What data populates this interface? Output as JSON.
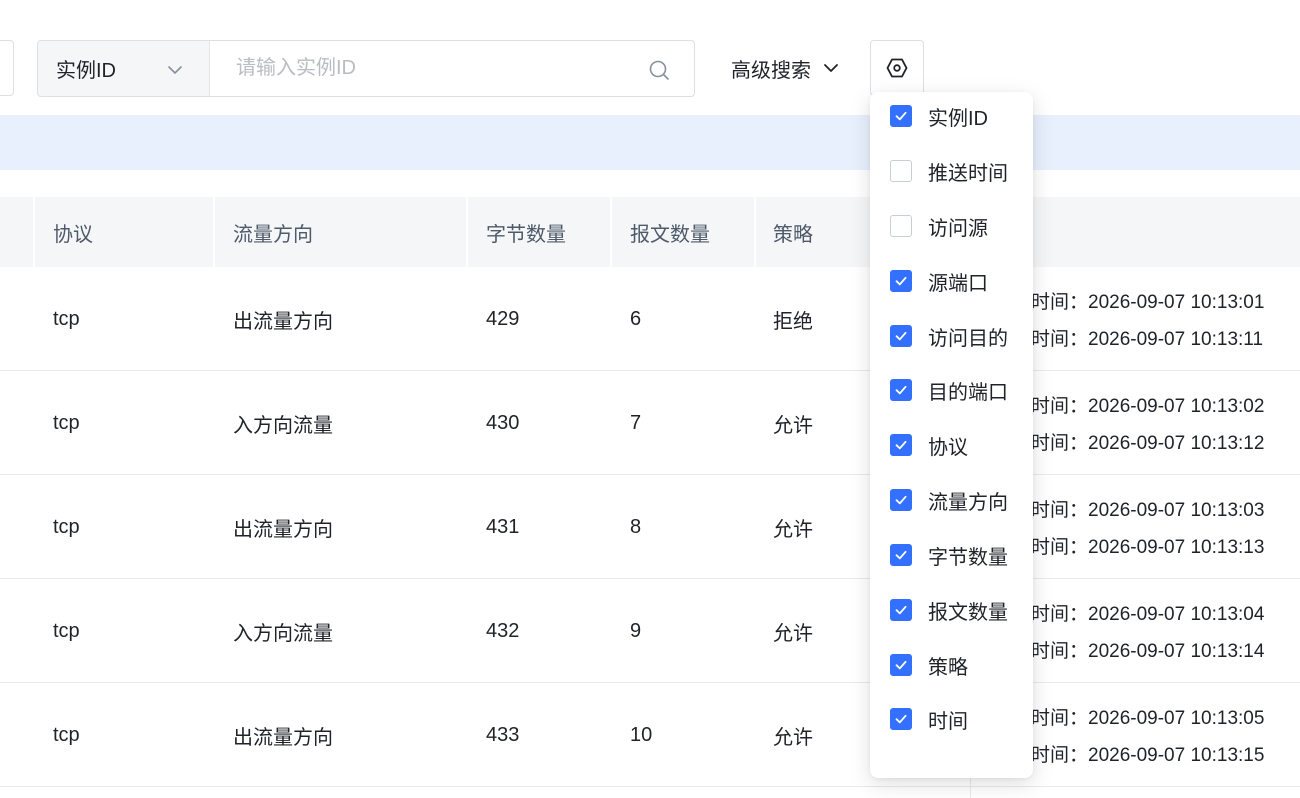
{
  "toolbar": {
    "select_value": "实例ID",
    "search_placeholder": "请输入实例ID",
    "advanced_search_label": "高级搜索"
  },
  "table": {
    "headers": [
      "协议",
      "流量方向",
      "字节数量",
      "报文数量",
      "策略"
    ],
    "rows": [
      {
        "protocol": "tcp",
        "direction": "出流量方向",
        "bytes": "429",
        "packets": "6",
        "policy": "拒绝",
        "time_1": "时间：2026-09-07 10:13:01",
        "time_2": "时间：2026-09-07 10:13:11"
      },
      {
        "protocol": "tcp",
        "direction": "入方向流量",
        "bytes": "430",
        "packets": "7",
        "policy": "允许",
        "time_1": "时间：2026-09-07 10:13:02",
        "time_2": "时间：2026-09-07 10:13:12"
      },
      {
        "protocol": "tcp",
        "direction": "出流量方向",
        "bytes": "431",
        "packets": "8",
        "policy": "允许",
        "time_1": "时间：2026-09-07 10:13:03",
        "time_2": "时间：2026-09-07 10:13:13"
      },
      {
        "protocol": "tcp",
        "direction": "入方向流量",
        "bytes": "432",
        "packets": "9",
        "policy": "允许",
        "time_1": "时间：2026-09-07 10:13:04",
        "time_2": "时间：2026-09-07 10:13:14"
      },
      {
        "protocol": "tcp",
        "direction": "出流量方向",
        "bytes": "433",
        "packets": "10",
        "policy": "允许",
        "time_1": "时间：2026-09-07 10:13:05",
        "time_2": "时间：2026-09-07 10:13:15"
      }
    ]
  },
  "column_menu": {
    "items": [
      {
        "label": "实例ID",
        "checked": true
      },
      {
        "label": "推送时间",
        "checked": false
      },
      {
        "label": "访问源",
        "checked": false
      },
      {
        "label": "源端口",
        "checked": true
      },
      {
        "label": "访问目的",
        "checked": true
      },
      {
        "label": "目的端口",
        "checked": true
      },
      {
        "label": "协议",
        "checked": true
      },
      {
        "label": "流量方向",
        "checked": true
      },
      {
        "label": "字节数量",
        "checked": true
      },
      {
        "label": "报文数量",
        "checked": true
      },
      {
        "label": "策略",
        "checked": true
      },
      {
        "label": "时间",
        "checked": true
      }
    ]
  },
  "colors": {
    "accent": "#3370ff",
    "info_bar": "#e8f0fe",
    "header_bg": "#f5f6f8"
  }
}
